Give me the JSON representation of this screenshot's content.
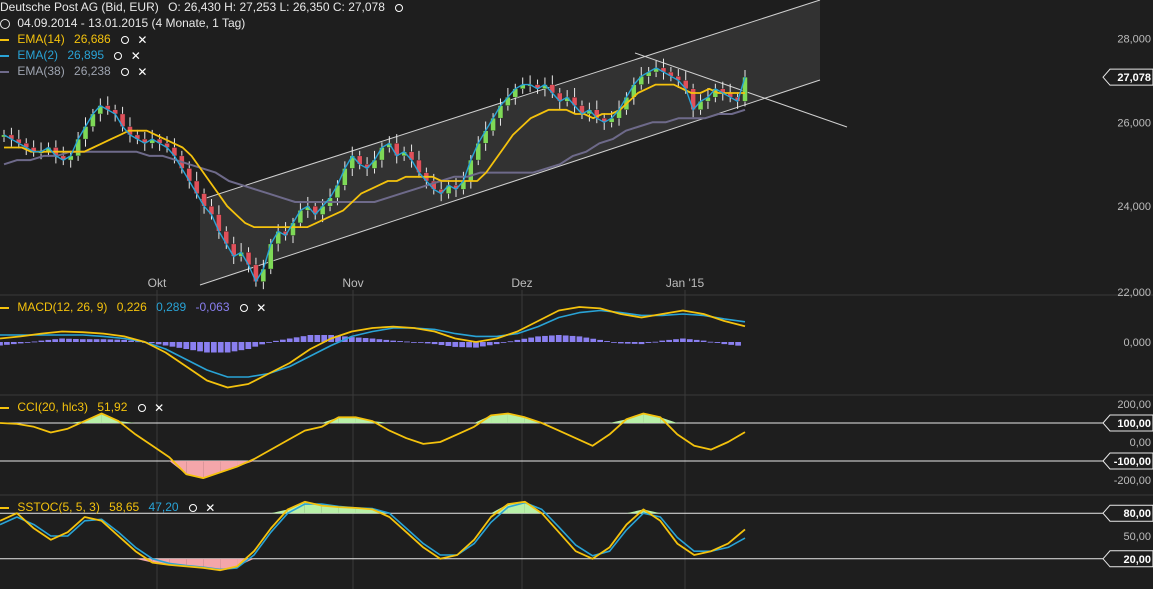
{
  "header": {
    "title": "Deutsche Post AG (Bid, EUR)",
    "ohlc": "O: 26,430   H: 27,253   L: 26,350   C: 27,078",
    "range": "04.09.2014 - 13.01.2015 (4 Monate, 1 Tag)"
  },
  "legend": {
    "ema14": {
      "label": "EMA(14)",
      "value": "26,686",
      "color": "#f4c20d"
    },
    "ema2": {
      "label": "EMA(2)",
      "value": "26,895",
      "color": "#29a3d6"
    },
    "ema38": {
      "label": "EMA(38)",
      "value": "26,238",
      "color": "#6e6a8a"
    }
  },
  "macd_legend": {
    "label": "MACD(12, 26, 9)",
    "v1": "0,226",
    "v2": "0,289",
    "v3": "-0,063"
  },
  "cci_legend": {
    "label": "CCI(20, hlc3)",
    "v1": "51,92"
  },
  "sstoc_legend": {
    "label": "SSTOC(5, 5, 3)",
    "v1": "58,65",
    "v2": "47,20"
  },
  "icons": {
    "toggle": "visibility-circle-icon",
    "remove": "close-x-icon",
    "clock": "clock-icon"
  },
  "colors": {
    "up": "#7ed957",
    "down": "#e0505a",
    "ema14": "#f4c20d",
    "ema2": "#29a3d6",
    "ema38": "#6e6a8a",
    "hist": "#8a7ff0",
    "cci_fill_up": "#b8f0a8",
    "cci_fill_down": "#f4a6aa"
  },
  "chart_data": [
    {
      "type": "candlestick",
      "title": "Deutsche Post AG (Bid, EUR)",
      "x_labels": [
        "Okt",
        "Nov",
        "Dez",
        "Jan '15"
      ],
      "y_ticks": [
        "28,000",
        "26,000",
        "24,000",
        "22,000"
      ],
      "ylim": [
        22,
        28.4
      ],
      "last_price_label": "27,078",
      "close": [
        25.7,
        25.6,
        25.5,
        25.4,
        25.3,
        25.3,
        25.4,
        25.2,
        25.1,
        25.2,
        25.6,
        25.9,
        26.2,
        26.4,
        26.3,
        26.2,
        25.9,
        25.7,
        25.6,
        25.5,
        25.6,
        25.5,
        25.4,
        25.2,
        24.9,
        24.6,
        24.3,
        24.0,
        23.8,
        23.4,
        23.1,
        22.8,
        22.9,
        22.6,
        22.2,
        22.5,
        23.1,
        23.4,
        23.3,
        23.6,
        23.9,
        24.0,
        23.8,
        24.0,
        24.2,
        24.5,
        24.9,
        25.2,
        25.0,
        24.9,
        25.1,
        25.4,
        25.5,
        25.2,
        25.3,
        25.1,
        24.8,
        24.6,
        24.4,
        24.3,
        24.5,
        24.4,
        24.6,
        25.1,
        25.5,
        25.8,
        26.1,
        26.4,
        26.6,
        26.8,
        26.9,
        26.9,
        26.8,
        26.9,
        26.7,
        26.5,
        26.6,
        26.4,
        26.2,
        26.3,
        26.1,
        26.0,
        26.1,
        26.3,
        26.6,
        26.9,
        27.1,
        27.2,
        27.3,
        27.2,
        27.1,
        27.0,
        26.8,
        26.3,
        26.5,
        26.6,
        26.8,
        26.7,
        26.6,
        26.5,
        27.08
      ],
      "ema14": [
        25.4,
        25.4,
        25.4,
        25.3,
        25.3,
        25.3,
        25.3,
        25.3,
        25.3,
        25.3,
        25.4,
        25.5,
        25.6,
        25.7,
        25.8,
        25.8,
        25.8,
        25.7,
        25.6,
        25.5,
        25.4,
        25.2,
        24.9,
        24.6,
        24.3,
        24.0,
        23.8,
        23.6,
        23.5,
        23.5,
        23.5,
        23.5,
        23.5,
        23.5,
        23.5,
        23.6,
        23.7,
        23.8,
        23.9,
        24.1,
        24.3,
        24.4,
        24.5,
        24.6,
        24.6,
        24.7,
        24.7,
        24.7,
        24.7,
        24.6,
        24.6,
        24.6,
        24.6,
        24.6,
        24.8,
        25.1,
        25.4,
        25.7,
        25.9,
        26.1,
        26.2,
        26.3,
        26.3,
        26.3,
        26.2,
        26.2,
        26.1,
        26.2,
        26.2,
        26.3,
        26.5,
        26.7,
        26.8,
        26.9,
        26.9,
        26.9,
        26.8,
        26.7,
        26.7,
        26.8,
        26.7,
        26.7,
        26.7,
        26.7
      ],
      "ema38": [
        25.0,
        25.1,
        25.1,
        25.2,
        25.2,
        25.3,
        25.3,
        25.3,
        25.3,
        25.3,
        25.3,
        25.2,
        25.2,
        25.1,
        25.0,
        24.9,
        24.8,
        24.6,
        24.5,
        24.4,
        24.3,
        24.2,
        24.1,
        24.1,
        24.1,
        24.1,
        24.1,
        24.1,
        24.1,
        24.2,
        24.3,
        24.4,
        24.5,
        24.6,
        24.7,
        24.7,
        24.8,
        24.8,
        24.8,
        24.8,
        24.8,
        24.9,
        25.0,
        25.2,
        25.3,
        25.5,
        25.6,
        25.8,
        25.9,
        26.0,
        26.0,
        26.1,
        26.1,
        26.1,
        26.2,
        26.2,
        26.3
      ]
    },
    {
      "type": "line",
      "title": "MACD(12, 26, 9)",
      "y_ticks": [
        "0,000"
      ],
      "series": [
        {
          "name": "MACD(12, 26, 9)",
          "values": [
            0.05,
            0.08,
            0.12,
            0.15,
            0.14,
            0.12,
            0.08,
            0.0,
            -0.15,
            -0.35,
            -0.55,
            -0.65,
            -0.6,
            -0.45,
            -0.3,
            -0.1,
            0.05,
            0.15,
            0.2,
            0.22,
            0.2,
            0.15,
            0.05,
            0.0,
            0.05,
            0.15,
            0.3,
            0.45,
            0.5,
            0.48,
            0.4,
            0.35,
            0.4,
            0.45,
            0.4,
            0.3,
            0.226
          ]
        },
        {
          "name": "signal",
          "values": [
            0.1,
            0.1,
            0.1,
            0.1,
            0.1,
            0.08,
            0.05,
            0.0,
            -0.1,
            -0.25,
            -0.4,
            -0.5,
            -0.5,
            -0.45,
            -0.35,
            -0.2,
            -0.05,
            0.08,
            0.15,
            0.2,
            0.2,
            0.18,
            0.12,
            0.08,
            0.08,
            0.12,
            0.22,
            0.35,
            0.42,
            0.45,
            0.42,
            0.38,
            0.38,
            0.4,
            0.38,
            0.33,
            0.289
          ]
        }
      ],
      "histogram": [
        -0.05,
        -0.02,
        0.02,
        0.05,
        0.04,
        0.04,
        0.03,
        0.0,
        -0.05,
        -0.1,
        -0.15,
        -0.15,
        -0.1,
        0.0,
        0.05,
        0.1,
        0.1,
        0.07,
        0.05,
        0.02,
        0.0,
        -0.03,
        -0.07,
        -0.08,
        -0.03,
        0.03,
        0.08,
        0.1,
        0.08,
        0.03,
        -0.02,
        -0.03,
        0.02,
        0.05,
        0.02,
        -0.03,
        -0.063
      ]
    },
    {
      "type": "line",
      "title": "CCI(20, hlc3)",
      "y_ticks": [
        "200,00",
        "100,00",
        "0,00",
        "-100,00",
        "-200,00"
      ],
      "ylim": [
        -200,
        200
      ],
      "series": [
        {
          "name": "CCI(20, hlc3)",
          "values": [
            100,
            95,
            80,
            50,
            70,
            110,
            150,
            110,
            40,
            -20,
            -80,
            -170,
            -190,
            -160,
            -130,
            -90,
            -40,
            10,
            60,
            80,
            130,
            130,
            110,
            60,
            20,
            -10,
            0,
            40,
            80,
            140,
            150,
            130,
            100,
            60,
            20,
            -20,
            40,
            120,
            150,
            130,
            40,
            -20,
            -40,
            0,
            51.92
          ]
        }
      ]
    },
    {
      "type": "line",
      "title": "SSTOC(5, 5, 3)",
      "y_ticks": [
        "80,00",
        "50,00",
        "20,00"
      ],
      "ylim": [
        0,
        100
      ],
      "series": [
        {
          "name": "SSTOC(5, 5, 3)",
          "values": [
            70,
            80,
            60,
            45,
            55,
            75,
            70,
            50,
            30,
            15,
            12,
            10,
            8,
            5,
            10,
            30,
            60,
            85,
            95,
            90,
            88,
            87,
            85,
            75,
            55,
            35,
            20,
            25,
            45,
            75,
            92,
            95,
            80,
            55,
            30,
            20,
            35,
            65,
            85,
            70,
            40,
            25,
            30,
            40,
            58.65
          ]
        },
        {
          "name": "signal",
          "values": [
            65,
            75,
            65,
            50,
            50,
            70,
            72,
            55,
            35,
            20,
            14,
            11,
            9,
            6,
            8,
            25,
            55,
            80,
            92,
            92,
            89,
            87,
            86,
            80,
            60,
            40,
            25,
            25,
            40,
            68,
            88,
            94,
            85,
            62,
            38,
            24,
            30,
            58,
            80,
            75,
            48,
            30,
            30,
            35,
            47.2
          ]
        }
      ]
    }
  ]
}
